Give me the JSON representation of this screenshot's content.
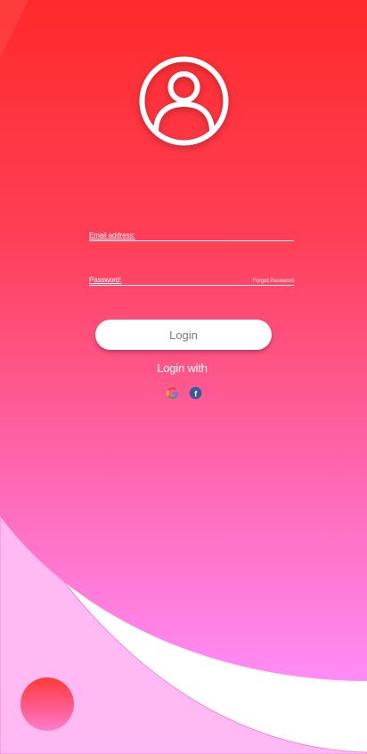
{
  "colors": {
    "gradient_top": "#ff2b2b",
    "gradient_bottom": "#ff88f4",
    "outer_arc": "#ffb9f3",
    "button_text": "#7a7a7a"
  },
  "header": {
    "avatar_icon": "user-circle-icon"
  },
  "form": {
    "email_label": "Email address:",
    "email_value": "",
    "password_label": "Password:",
    "password_value": "",
    "forgot_label": "Forgot Password",
    "login_button": "Login"
  },
  "social": {
    "title": "Login with",
    "providers": [
      {
        "icon": "google-icon"
      },
      {
        "icon": "facebook-icon",
        "glyph": "f"
      }
    ]
  }
}
